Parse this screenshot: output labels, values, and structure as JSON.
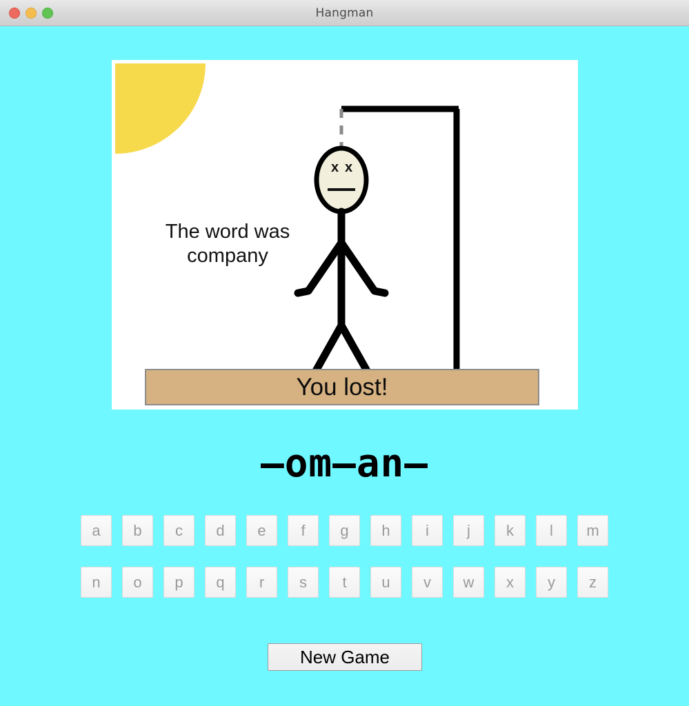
{
  "window": {
    "title": "Hangman",
    "controls": [
      {
        "name": "close-button",
        "color": "#ec6a5e"
      },
      {
        "name": "minimize-button",
        "color": "#f5bd4f"
      },
      {
        "name": "zoom-button",
        "color": "#61c454"
      }
    ]
  },
  "theme": {
    "background": "#6ff8ff",
    "canvas_background": "#ffffff",
    "sun_color": "#f7d94c",
    "banner_background": "#d6b282",
    "banner_border": "#8c8c8c",
    "ink": "#000000",
    "head_fill": "#f2f0dc",
    "rope_color": "#8a8a8a",
    "disabled_key_text": "#9a9a9a"
  },
  "scene": {
    "message_line1": "The word was",
    "message_line2": "company",
    "banner_text": "You lost!",
    "face": {
      "left_eye": "x",
      "right_eye": "x",
      "expression": "dead"
    }
  },
  "word_display": "–om–an–",
  "keyboard": {
    "row1": [
      "a",
      "b",
      "c",
      "d",
      "e",
      "f",
      "g",
      "h",
      "i",
      "j",
      "k",
      "l",
      "m"
    ],
    "row2": [
      "n",
      "o",
      "p",
      "q",
      "r",
      "s",
      "t",
      "u",
      "v",
      "w",
      "x",
      "y",
      "z"
    ],
    "all_disabled": true
  },
  "actions": {
    "new_game_label": "New Game"
  }
}
